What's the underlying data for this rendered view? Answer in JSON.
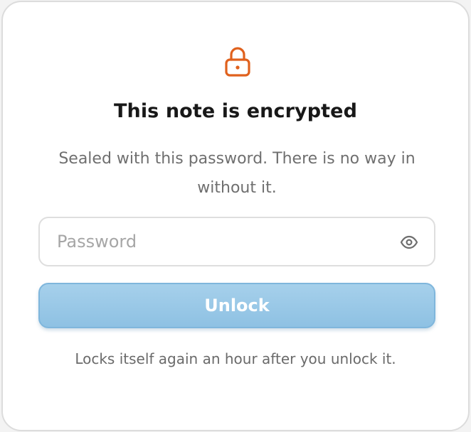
{
  "dialog": {
    "icon": "lock-icon",
    "accent_color": "#e0611d",
    "title": "This note is encrypted",
    "description": "Sealed with this password. There is no way in without it.",
    "password": {
      "placeholder": "Password",
      "value": "",
      "reveal_icon": "eye-icon"
    },
    "unlock_label": "Unlock",
    "unlock_color": "#96c6e6",
    "footer_note": "Locks itself again an hour after you unlock it."
  }
}
